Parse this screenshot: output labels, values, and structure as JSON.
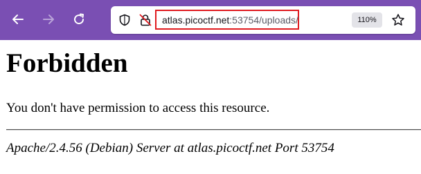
{
  "browser": {
    "url_host": "atlas.picoctf.net",
    "url_rest": ":53754/uploads/",
    "zoom_level": "110%",
    "icons": [
      "back-arrow-icon",
      "forward-arrow-icon",
      "reload-icon",
      "shield-icon",
      "lock-slash-icon",
      "star-icon"
    ],
    "colors": {
      "toolbar": "#7a4fb3",
      "highlight": "#e0191e"
    }
  },
  "page": {
    "heading": "Forbidden",
    "message": "You don't have permission to access this resource.",
    "server_signature": "Apache/2.4.56 (Debian) Server at atlas.picoctf.net Port 53754"
  }
}
